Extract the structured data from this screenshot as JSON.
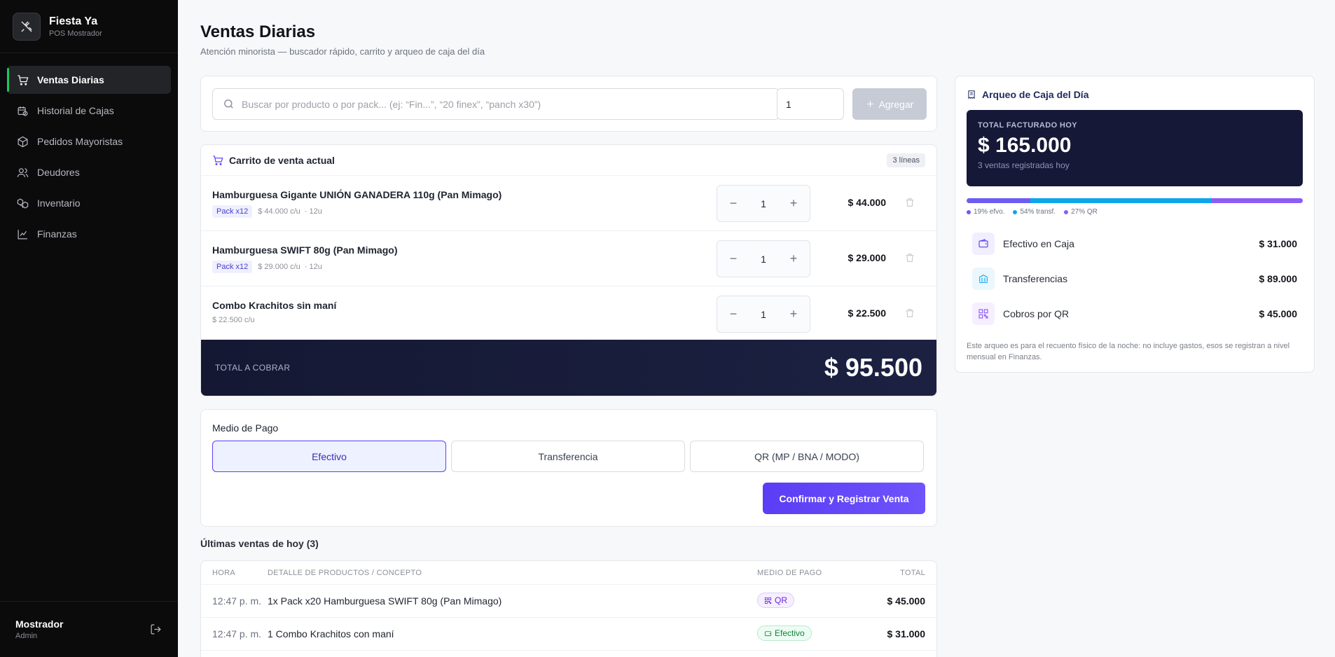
{
  "brand": {
    "name": "Fiesta Ya",
    "subtitle": "POS Mostrador"
  },
  "sidebar": {
    "items": [
      {
        "label": "Ventas Diarias",
        "icon": "cart-icon",
        "active": true
      },
      {
        "label": "Historial de Cajas",
        "icon": "calendar-clock-icon"
      },
      {
        "label": "Pedidos Mayoristas",
        "icon": "package-icon"
      },
      {
        "label": "Deudores",
        "icon": "users-icon"
      },
      {
        "label": "Inventario",
        "icon": "boxes-icon"
      },
      {
        "label": "Finanzas",
        "icon": "line-chart-icon"
      }
    ],
    "user": {
      "name": "Mostrador",
      "role": "Admin"
    }
  },
  "page": {
    "title": "Ventas Diarias",
    "subtitle": "Atención minorista — buscador rápido, carrito y arqueo de caja del día"
  },
  "search": {
    "placeholder": "Buscar por producto o por pack... (ej: “Fin...”, “20 finex”, “panch x30”)",
    "quantity": "1",
    "add_label": "Agregar"
  },
  "cart": {
    "title": "Carrito de venta actual",
    "lines_badge": "3 líneas",
    "lines": [
      {
        "name": "Hamburguesa Gigante UNIÓN GANADERA 110g (Pan Mimago)",
        "pack": "Pack x12",
        "unit_price": "$ 44.000 c/u",
        "units": "· 12u",
        "qty": "1",
        "total": "$ 44.000"
      },
      {
        "name": "Hamburguesa SWIFT 80g (Pan Mimago)",
        "pack": "Pack x12",
        "unit_price": "$ 29.000 c/u",
        "units": "· 12u",
        "qty": "1",
        "total": "$ 29.000"
      },
      {
        "name": "Combo Krachitos sin maní",
        "pack": "",
        "unit_price": "$ 22.500 c/u",
        "units": "",
        "qty": "1",
        "total": "$ 22.500"
      }
    ],
    "total_label": "TOTAL A COBRAR",
    "total_value": "$ 95.500"
  },
  "payment": {
    "title": "Medio de Pago",
    "options": [
      "Efectivo",
      "Transferencia",
      "QR (MP / BNA / MODO)"
    ],
    "selected": "Efectivo",
    "confirm_label": "Confirmar y Registrar Venta"
  },
  "recent": {
    "title": "Últimas ventas de hoy (3)",
    "headers": [
      "HORA",
      "DETALLE DE PRODUCTOS / CONCEPTO",
      "MEDIO DE PAGO",
      "TOTAL"
    ],
    "rows": [
      {
        "time": "12:47 p. m.",
        "detail": "1x Pack x20 Hamburguesa SWIFT 80g (Pan Mimago)",
        "method": "QR",
        "total": "$ 45.000"
      },
      {
        "time": "12:47 p. m.",
        "detail": "1 Combo Krachitos con maní",
        "method": "Efectivo",
        "total": "$ 31.000"
      }
    ]
  },
  "arqueo": {
    "title": "Arqueo de Caja del Día",
    "total_label": "TOTAL FACTURADO HOY",
    "total_value": "$ 165.000",
    "total_sub": "3 ventas registradas hoy",
    "distribution": [
      {
        "label": "19% efvo.",
        "percent": 19,
        "color": "#6d5cf0"
      },
      {
        "label": "54% transf.",
        "percent": 54,
        "color": "#0ea5e9"
      },
      {
        "label": "27% QR",
        "percent": 27,
        "color": "#8b5cf6"
      }
    ],
    "rows": [
      {
        "label": "Efectivo en Caja",
        "value": "$ 31.000",
        "icon": "wallet-icon"
      },
      {
        "label": "Transferencias",
        "value": "$ 89.000",
        "icon": "bank-icon"
      },
      {
        "label": "Cobros por QR",
        "value": "$ 45.000",
        "icon": "qr-icon"
      }
    ],
    "note": "Este arqueo es para el recuento físico de la noche: no incluye gastos, esos se registran a nivel mensual en Finanzas."
  }
}
